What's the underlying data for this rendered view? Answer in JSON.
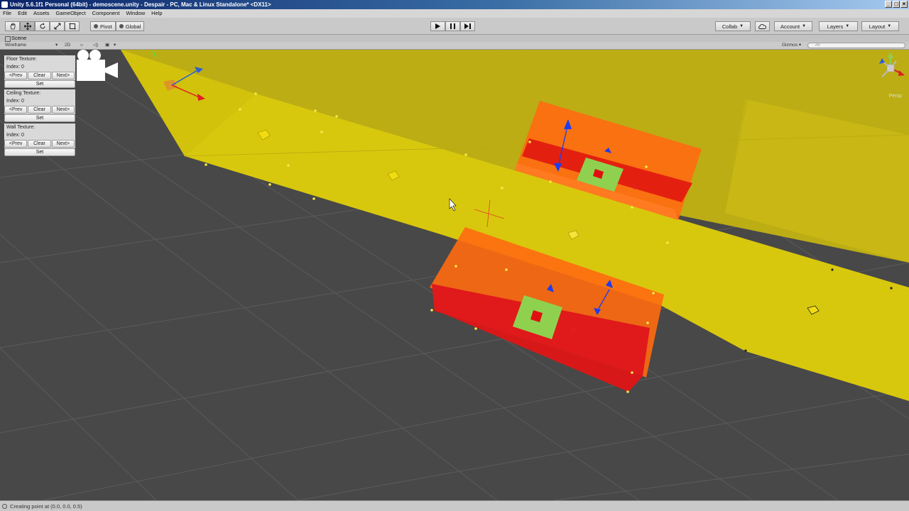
{
  "window": {
    "title": "Unity 5.6.1f1 Personal (64bit) - demoscene.unity - Despair - PC, Mac & Linux Standalone* <DX11>",
    "controls": [
      "_",
      "□",
      "×"
    ]
  },
  "menu": [
    "File",
    "Edit",
    "Assets",
    "GameObject",
    "Component",
    "Window",
    "Help"
  ],
  "toolbar": {
    "pivot_label": "Pivot",
    "global_label": "Global",
    "collab_label": "Collab",
    "account_label": "Account",
    "layers_label": "Layers",
    "layout_label": "Layout"
  },
  "scene": {
    "tab_label": "Scene",
    "shading_mode": "Wireframe",
    "mode_2d": "2D",
    "gizmos_label": "Gizmos",
    "search_placeholder": "All",
    "persp_label": "Persp"
  },
  "texture_panel": {
    "sections": [
      {
        "title": "Floor Texture:",
        "index": "Index: 0"
      },
      {
        "title": "Ceiling Texture:",
        "index": "Index: 0"
      },
      {
        "title": "Wall Texture:",
        "index": "Index: 0"
      }
    ],
    "prev_label": "<Prev",
    "clear_label": "Clear",
    "next_label": "Next>",
    "set_label": "Set"
  },
  "status": {
    "message": "Creating point at (0.0, 0.0, 0.5)"
  },
  "colors": {
    "floor": "#d8c80d",
    "room": "#e12010",
    "room_edge": "#ff6a10",
    "marker": "#8fd14f",
    "grid": "#5a5a5a",
    "background": "#484848"
  }
}
